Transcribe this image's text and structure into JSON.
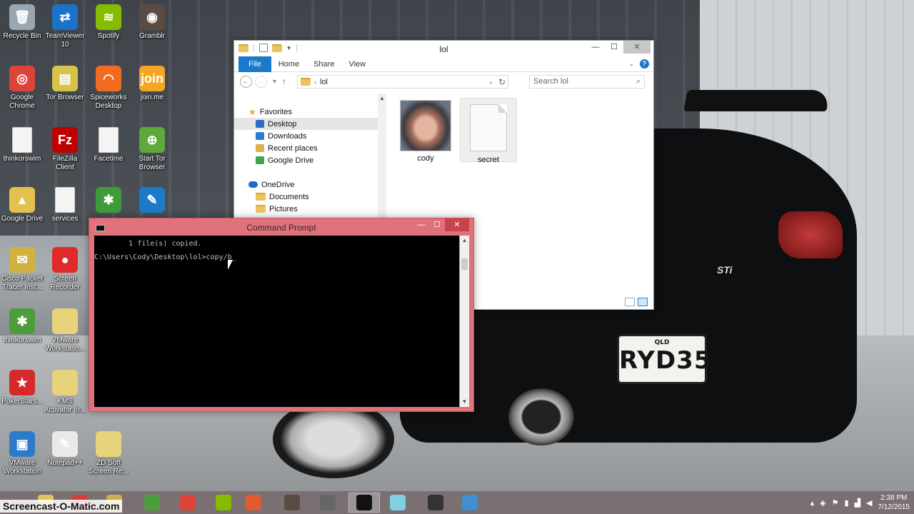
{
  "desktop": {
    "icons": [
      {
        "label": "Recycle Bin",
        "icon": "recycle-bin-icon",
        "color": "#9aa7b3",
        "glyph": "🗑"
      },
      {
        "label": "TeamViewer 10",
        "icon": "teamviewer-icon",
        "color": "#1a73c8",
        "glyph": "⇄"
      },
      {
        "label": "Spotify",
        "icon": "spotify-icon",
        "color": "#84bd00",
        "glyph": "≋"
      },
      {
        "label": "Gramblr",
        "icon": "gramblr-icon",
        "color": "#5a4b43",
        "glyph": "◉"
      },
      {
        "label": "Google Chrome",
        "icon": "chrome-icon",
        "color": "#db4437",
        "glyph": "◎"
      },
      {
        "label": "Tor Browser",
        "icon": "tor-browser-icon",
        "color": "#d8c24a",
        "glyph": "▤"
      },
      {
        "label": "Spiceworks Desktop",
        "icon": "spiceworks-icon",
        "color": "#f26b21",
        "glyph": "◠"
      },
      {
        "label": "join.me",
        "icon": "joinme-icon",
        "color": "#f5a623",
        "glyph": "join"
      },
      {
        "label": "thinkorswim",
        "icon": "document-icon",
        "color": "#f4f4f4",
        "glyph": ""
      },
      {
        "label": "FileZilla Client",
        "icon": "filezilla-icon",
        "color": "#bf0000",
        "glyph": "Fz"
      },
      {
        "label": "Facetime",
        "icon": "document-icon",
        "color": "#f4f4f4",
        "glyph": ""
      },
      {
        "label": "Start Tor Browser",
        "icon": "tor-globe-icon",
        "color": "#5fa83a",
        "glyph": "⊕"
      },
      {
        "label": "Google Drive",
        "icon": "google-drive-icon",
        "color": "#e2c24c",
        "glyph": "▲"
      },
      {
        "label": "services",
        "icon": "document-icon",
        "color": "#f4f4f4",
        "glyph": ""
      },
      {
        "label": "",
        "icon": "app-green-icon",
        "color": "#3f9c3a",
        "glyph": "✱"
      },
      {
        "label": "",
        "icon": "app-compass-icon",
        "color": "#1c7bc9",
        "glyph": "✎"
      },
      {
        "label": "Cisco Packet Tracer Inst...",
        "icon": "packet-tracer-icon",
        "color": "#d2b23e",
        "glyph": "✉"
      },
      {
        "label": "Screen Recorder",
        "icon": "screen-recorder-icon",
        "color": "#e02a2a",
        "glyph": "●"
      },
      {
        "label": "thinkorswim",
        "icon": "thinkorswim-icon",
        "color": "#4d9d3d",
        "glyph": "✱"
      },
      {
        "label": "VMware Workstatio...",
        "icon": "folder-icon",
        "color": "#e8d27a",
        "glyph": ""
      },
      {
        "label": "PokerStars...",
        "icon": "pokerstars-icon",
        "color": "#d62a2a",
        "glyph": "★"
      },
      {
        "label": "KMS Activator fo...",
        "icon": "folder-icon",
        "color": "#e8d27a",
        "glyph": ""
      },
      {
        "label": "VMware Workstation",
        "icon": "vmware-icon",
        "color": "#2c7ac9",
        "glyph": "▣"
      },
      {
        "label": "Notepad++",
        "icon": "notepadpp-icon",
        "color": "#e9e9e9",
        "glyph": "✎"
      },
      {
        "label": "ZD Soft Screen Re...",
        "icon": "folder-icon",
        "color": "#e8d27a",
        "glyph": ""
      }
    ]
  },
  "explorer": {
    "title": "lol",
    "tabs": [
      "File",
      "Home",
      "Share",
      "View"
    ],
    "address": "lol",
    "search_placeholder": "Search lol",
    "nav": {
      "favorites": "Favorites",
      "favorites_items": [
        "Desktop",
        "Downloads",
        "Recent places",
        "Google Drive"
      ],
      "selected": "Desktop",
      "onedrive": "OneDrive",
      "onedrive_items": [
        "Documents",
        "Pictures"
      ]
    },
    "files": [
      {
        "name": "cody",
        "type": "image"
      },
      {
        "name": "secret",
        "type": "file"
      }
    ]
  },
  "cmd": {
    "title": "Command Prompt",
    "lines": [
      "        1 file(s) copied.",
      "",
      "C:\\Users\\Cody\\Desktop\\lol>copy/b_"
    ]
  },
  "wallpaper": {
    "plate_top": "QLD",
    "plate": "RYD35",
    "badge": "STi"
  },
  "taskbar": {
    "watermark": "Screencast-O-Matic.com",
    "apps": [
      {
        "name": "file-explorer-icon",
        "color": "#e4c35b",
        "active": false
      },
      {
        "name": "app-icon",
        "color": "#d63b3b",
        "active": false
      },
      {
        "name": "app-icon",
        "color": "#c9b04a",
        "active": false
      },
      {
        "name": "thinkorswim-icon",
        "color": "#4d9d3d",
        "active": false
      },
      {
        "name": "chrome-icon",
        "color": "#db4437",
        "active": false
      },
      {
        "name": "spotify-icon",
        "color": "#84bd00",
        "active": false
      },
      {
        "name": "compass-icon",
        "color": "#e05a32",
        "active": false
      },
      {
        "name": "gramblr-icon",
        "color": "#5a4b43",
        "active": false
      },
      {
        "name": "app-icon",
        "color": "#666666",
        "active": false
      },
      {
        "name": "command-prompt-icon",
        "color": "#111111",
        "active": true
      },
      {
        "name": "app-icon",
        "color": "#7fd0e0",
        "active": false
      },
      {
        "name": "snipping-icon",
        "color": "#333333",
        "active": false
      },
      {
        "name": "screen-icon",
        "color": "#3f8fd2",
        "active": false
      }
    ],
    "time": "2:38 PM",
    "date": "7/12/2015"
  }
}
